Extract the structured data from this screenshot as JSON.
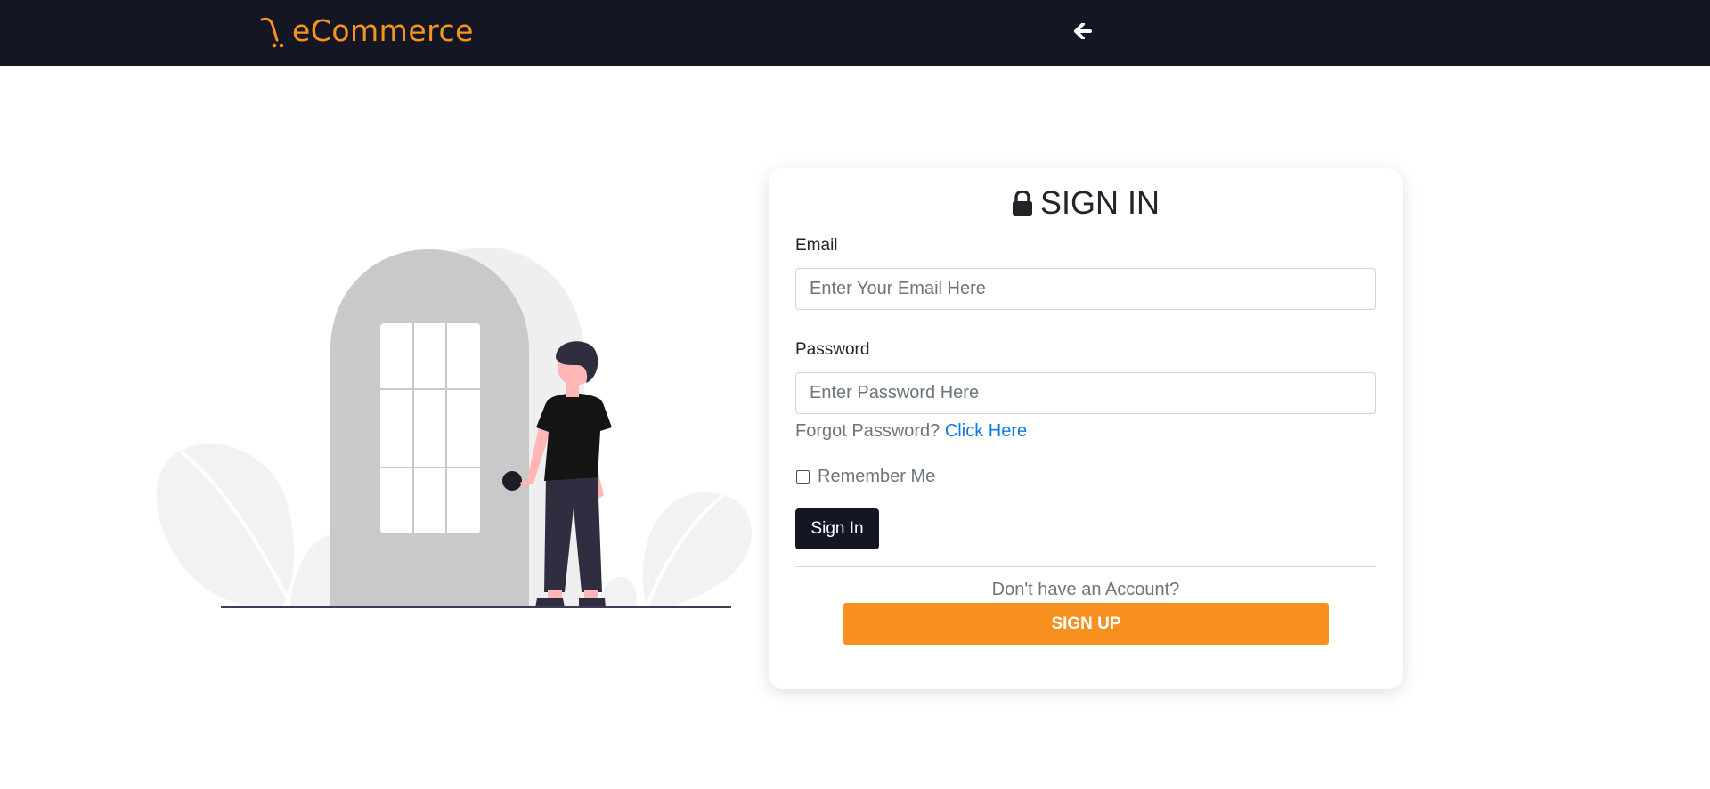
{
  "header": {
    "logo_text": "eCommerce",
    "logo_icon": "cart-icon",
    "back_icon": "arrow-left-icon",
    "background_color": "#141624",
    "brand_color": "#f7941d"
  },
  "illustration": {
    "subject": "person-standing-at-door-illustration"
  },
  "signin_card": {
    "title": "SIGN IN",
    "title_icon": "lock-icon",
    "email": {
      "label": "Email",
      "placeholder": "Enter Your Email Here",
      "value": ""
    },
    "password": {
      "label": "Password",
      "placeholder": "Enter Password Here",
      "value": ""
    },
    "forgot": {
      "text": "Forgot Password?",
      "link_label": "Click Here"
    },
    "remember": {
      "label": "Remember Me",
      "checked": false
    },
    "signin_button_label": "Sign In",
    "no_account_text": "Don't have an Account?",
    "signup_button_label": "SIGN UP",
    "accent_color": "#f7901e"
  }
}
